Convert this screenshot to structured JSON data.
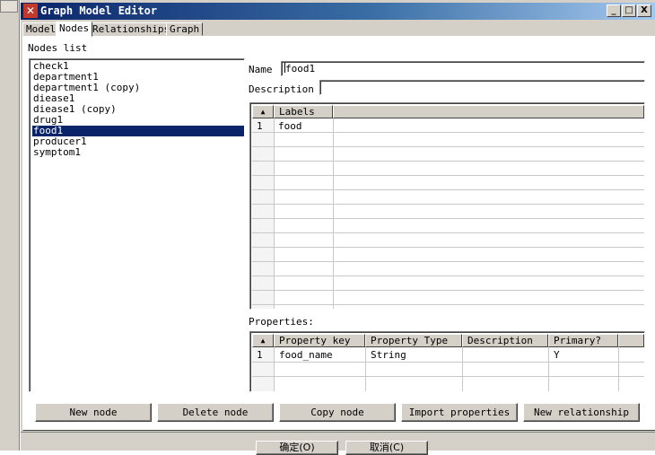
{
  "window": {
    "title": "Graph Model Editor",
    "title_icon": "tools-icon",
    "controls": {
      "minimize": "_",
      "maximize": "□",
      "close": "X"
    }
  },
  "tabs": [
    {
      "label": "Model"
    },
    {
      "label": "Nodes",
      "active": true
    },
    {
      "label": "Relationships"
    },
    {
      "label": "Graph"
    }
  ],
  "nodes_panel": {
    "title": "Nodes list",
    "items": [
      {
        "label": "check1"
      },
      {
        "label": "department1"
      },
      {
        "label": "department1 (copy)"
      },
      {
        "label": "diease1"
      },
      {
        "label": "diease1 (copy)"
      },
      {
        "label": "drug1"
      },
      {
        "label": "food1",
        "selected": true
      },
      {
        "label": "producer1"
      },
      {
        "label": "symptom1"
      }
    ]
  },
  "form": {
    "name_label": "Name",
    "name_value": "food1",
    "description_label": "Description",
    "description_value": ""
  },
  "labels_table": {
    "corner_icon": "sort-up-icon",
    "column": "Labels",
    "rows": [
      {
        "index": "1",
        "value": "food"
      }
    ]
  },
  "properties": {
    "title": "Properties:",
    "corner_icon": "sort-up-icon",
    "columns": [
      "Property key",
      "Property Type",
      "Description",
      "Primary?"
    ],
    "rows": [
      {
        "index": "1",
        "key": "food_name",
        "type": "String",
        "description": "",
        "primary": "Y"
      }
    ]
  },
  "buttons": {
    "new_node": "New node",
    "delete_node": "Delete node",
    "copy_node": "Copy node",
    "import_properties": "Import properties",
    "new_relationship": "New relationship"
  },
  "dialog_buttons": {
    "ok": "确定(O)",
    "cancel": "取消(C)"
  },
  "colors": {
    "selection": "#0a246a",
    "title_start": "#0a246a",
    "title_end": "#a6caf0",
    "face": "#d4d0c8"
  }
}
